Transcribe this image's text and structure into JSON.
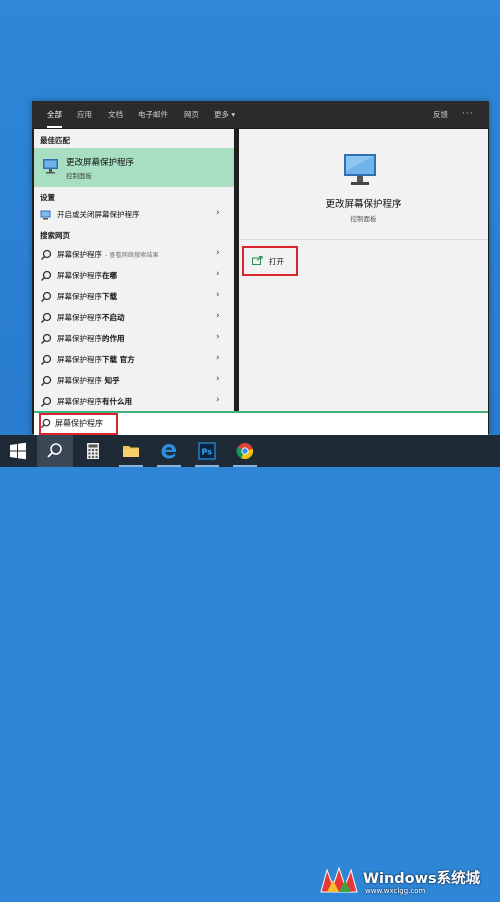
{
  "tabs": [
    {
      "label": "全部"
    },
    {
      "label": "应用"
    },
    {
      "label": "文档"
    },
    {
      "label": "电子邮件"
    },
    {
      "label": "网页"
    },
    {
      "label": "更多 ▾"
    }
  ],
  "topbar": {
    "feedback": "反馈",
    "more_options": "···"
  },
  "best_match": {
    "section": "最佳匹配",
    "title": "更改屏幕保护程序",
    "subtitle": "控制面板"
  },
  "settings": {
    "section": "设置",
    "item": "开启或关闭屏幕保护程序"
  },
  "web": {
    "section": "搜索网页",
    "items": [
      {
        "base": "屏幕保护程序",
        "suffix": "",
        "hint": "- 查看网络搜索结果"
      },
      {
        "base": "屏幕保护程序",
        "suffix": "在哪",
        "hint": ""
      },
      {
        "base": "屏幕保护程序",
        "suffix": "下载",
        "hint": ""
      },
      {
        "base": "屏幕保护程序",
        "suffix": "不启动",
        "hint": ""
      },
      {
        "base": "屏幕保护程序",
        "suffix": "的作用",
        "hint": ""
      },
      {
        "base": "屏幕保护程序",
        "suffix": "下载 官方",
        "hint": ""
      },
      {
        "base": "屏幕保护程序",
        "suffix": " 知乎",
        "hint": ""
      },
      {
        "base": "屏幕保护程序",
        "suffix": "有什么用",
        "hint": ""
      }
    ]
  },
  "preview": {
    "title": "更改屏幕保护程序",
    "subtitle": "控制面板",
    "open_label": "打开"
  },
  "search": {
    "value": "屏幕保护程序"
  },
  "watermark": {
    "text": "Windows系统城",
    "url": "www.wxclgg.com"
  },
  "colors": {
    "accent_green": "#3fb27f",
    "highlight_red": "#d9252e",
    "best_match_bg": "#a8dfc3"
  }
}
